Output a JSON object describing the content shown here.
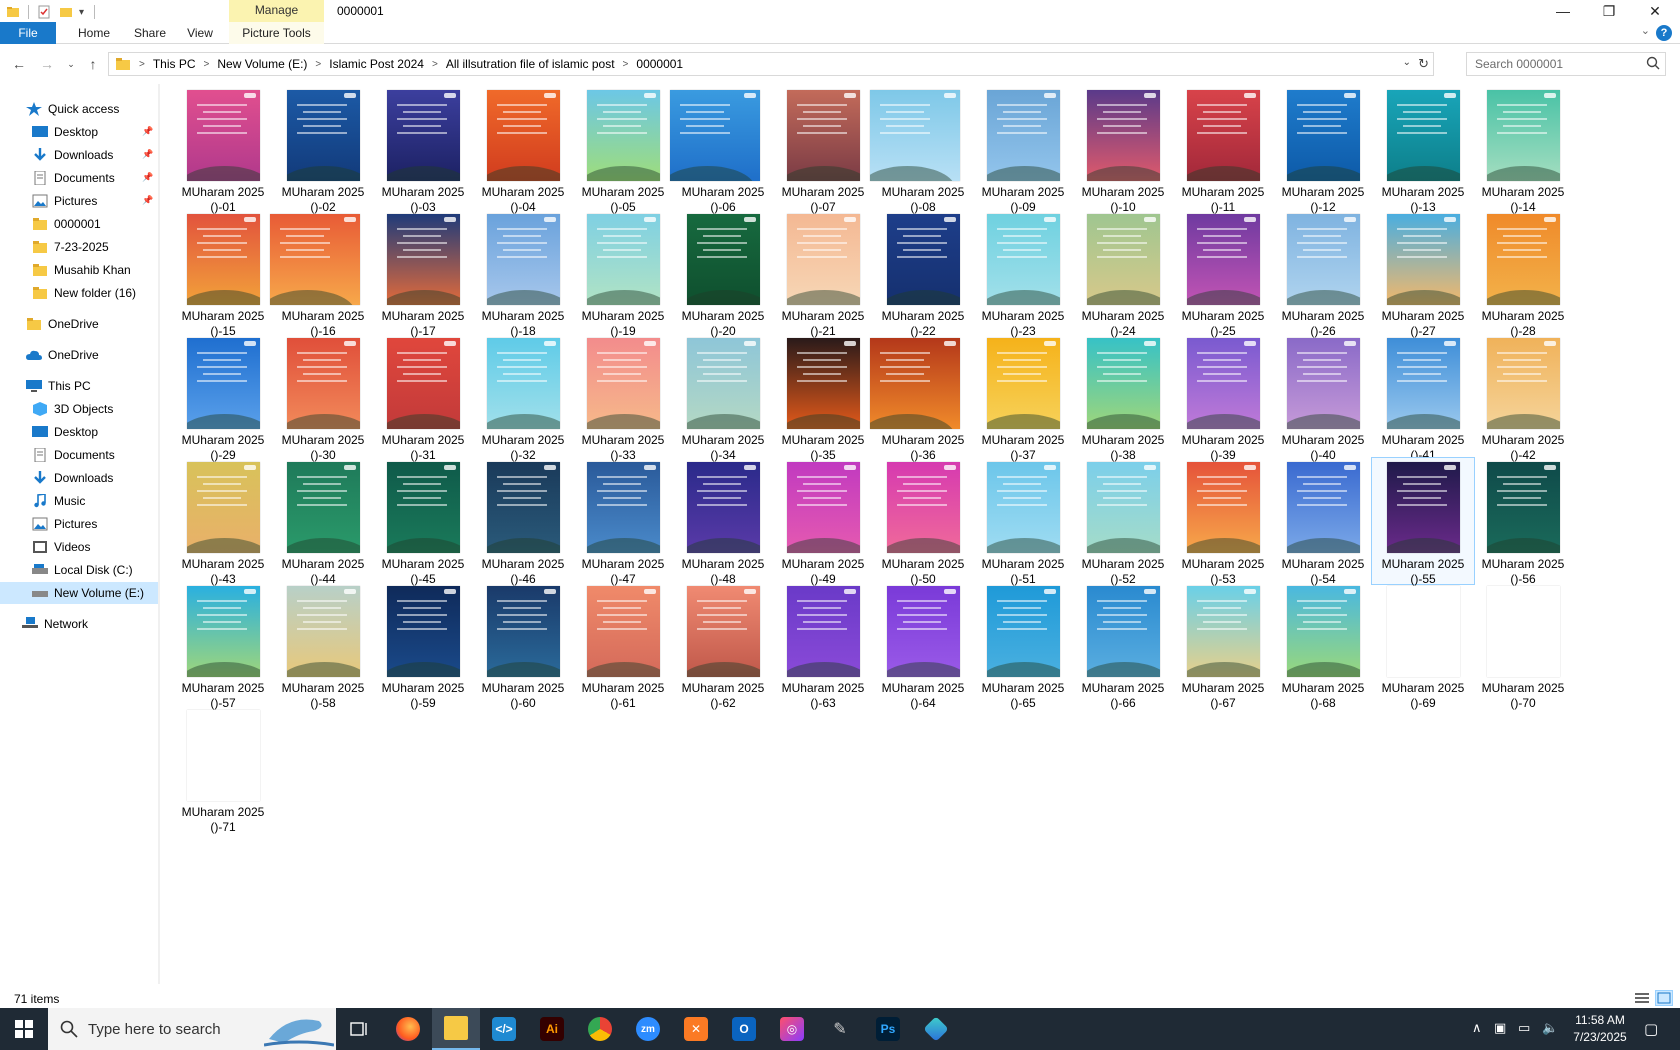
{
  "window": {
    "title": "0000001",
    "manage_label": "Manage",
    "controls": {
      "minimize": "—",
      "restore": "❐",
      "close": "✕"
    }
  },
  "ribbon": {
    "tabs": [
      "File",
      "Home",
      "Share",
      "View"
    ],
    "picture_tools": "Picture Tools",
    "help": "?"
  },
  "address": {
    "crumbs": [
      "This PC",
      "New Volume (E:)",
      "Islamic Post 2024",
      "All illsutration file of islamic post",
      "0000001"
    ],
    "search_placeholder": "Search 0000001"
  },
  "nav": {
    "quick_access": "Quick access",
    "quick_items": [
      "Desktop",
      "Downloads",
      "Documents",
      "Pictures",
      "0000001",
      "7-23-2025",
      "Musahib Khan",
      "New folder (16)"
    ],
    "onedrive_1": "OneDrive",
    "onedrive_2": "OneDrive",
    "this_pc": "This PC",
    "pc_items": [
      "3D Objects",
      "Desktop",
      "Documents",
      "Downloads",
      "Music",
      "Pictures",
      "Videos",
      "Local Disk (C:)",
      "New Volume (E:)"
    ],
    "network": "Network"
  },
  "files": {
    "name_prefix": "MUharam 2025",
    "suffix_prefix": "()-",
    "count": 71,
    "blank_items": [
      69,
      70,
      71
    ],
    "selected_item": 55
  },
  "status": {
    "item_count": "71 items"
  },
  "taskbar": {
    "search_text": "Type here to search",
    "time": "11:58 AM",
    "date": "7/23/2025"
  },
  "colors": {
    "accent": "#1979ca",
    "selection": "#cce8ff",
    "taskbar": "#1f2a35"
  }
}
